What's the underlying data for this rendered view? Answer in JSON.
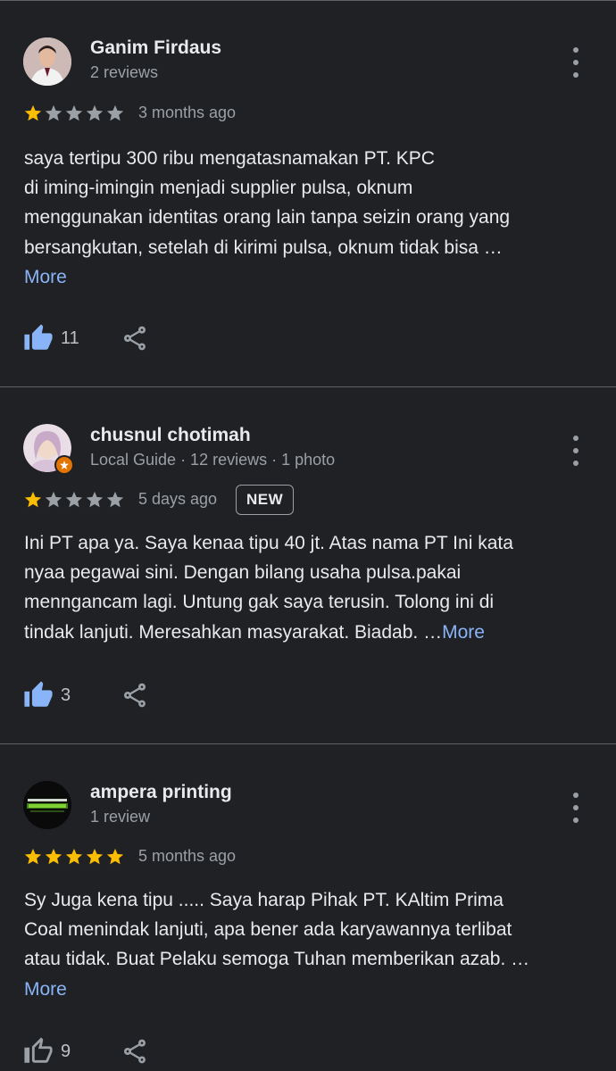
{
  "reviews": [
    {
      "name": "Ganim Firdaus",
      "meta": "2 reviews",
      "rating": 1,
      "date": "3 months ago",
      "badge": "",
      "lines": [
        "saya tertipu 300 ribu mengatasnamakan PT. KPC",
        "di iming-imingin menjadi supplier pulsa, oknum",
        "menggunakan identitas orang lain tanpa seizin orang yang",
        "bersangkutan, setelah di kirimi pulsa, oknum tidak bisa …"
      ],
      "more_label": "More",
      "likes": "11",
      "liked": true
    },
    {
      "name": "chusnul chotimah",
      "meta": "Local Guide · 12 reviews · 1 photo",
      "rating": 1,
      "date": "5 days ago",
      "badge": "NEW",
      "lines": [
        "Ini PT apa ya. Saya kenaa tipu 40 jt. Atas nama PT Ini kata",
        "nyaa pegawai sini. Dengan bilang usaha pulsa.pakai",
        "menngancam lagi. Untung gak saya terusin. Tolong ini di",
        "tindak lanjuti. Meresahkan masyarakat. Biadab. …"
      ],
      "more_label": "More",
      "likes": "3",
      "liked": true
    },
    {
      "name": "ampera printing",
      "meta": "1 review",
      "rating": 5,
      "date": "5 months ago",
      "badge": "",
      "lines": [
        "Sy Juga kena tipu ..... Saya harap Pihak PT. KAltim Prima",
        "Coal menindak lanjuti, apa bener ada karyawannya terlibat",
        "atau tidak. Buat Pelaku semoga Tuhan memberikan azab. …"
      ],
      "more_label": "More",
      "likes": "9",
      "liked": false
    }
  ],
  "colors": {
    "background": "#202124",
    "star_filled": "#fbbc04",
    "star_empty": "#9aa0a6",
    "link": "#8ab4f8",
    "like_active": "#8ab4f8"
  },
  "icons": [
    "thumb-up-icon",
    "share-icon",
    "more-vert-icon",
    "star-icon",
    "local-guide-icon"
  ]
}
